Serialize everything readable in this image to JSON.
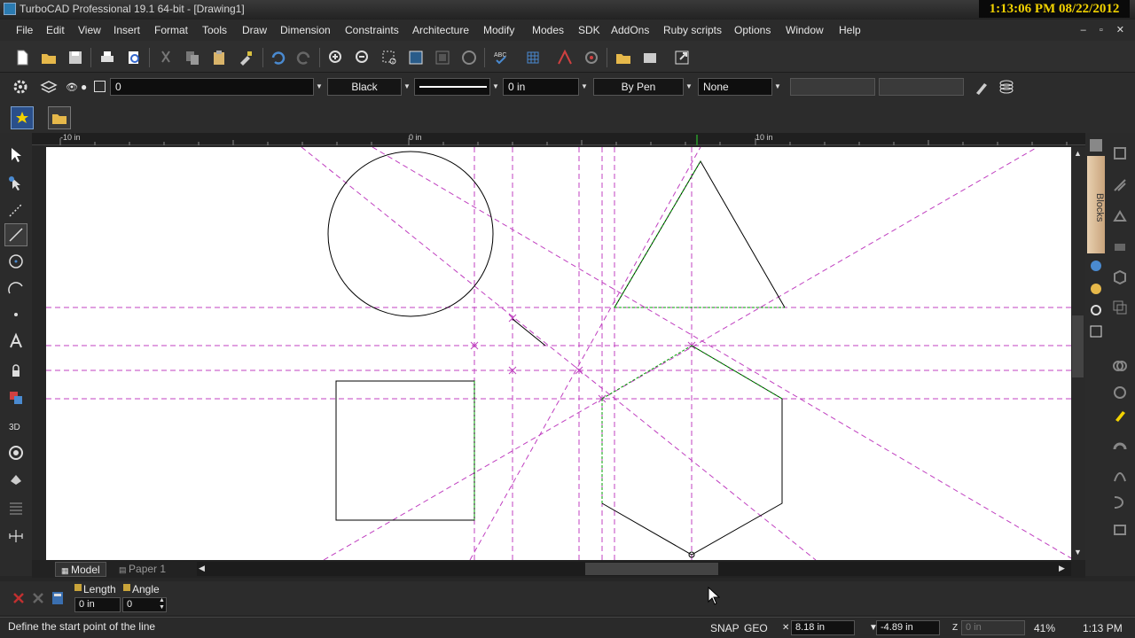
{
  "window": {
    "title": "TurboCAD Professional 19.1 64-bit - [Drawing1]",
    "controls": "– ▫ ✕"
  },
  "clock": "1:13:06 PM 08/22/2012",
  "menu": [
    "File",
    "Edit",
    "View",
    "Insert",
    "Format",
    "Tools",
    "Draw",
    "Dimension",
    "Constraints",
    "Architecture",
    "Modify",
    "Modes",
    "SDK",
    "AddOns",
    "Ruby scripts",
    "Options",
    "Window",
    "Help"
  ],
  "properties": {
    "layer": "0",
    "color": "Black",
    "line_width": "0 in",
    "pen": "By Pen",
    "fill": "None"
  },
  "ruler": {
    "labels": [
      "-10 in",
      "0 in",
      "10 in"
    ]
  },
  "right_panel": {
    "blocks_tab": "Blocks"
  },
  "sheets": {
    "model": "Model",
    "paper": "Paper 1"
  },
  "inspector": {
    "length_label": "Length",
    "angle_label": "Angle",
    "length_value": "0 in",
    "angle_value": "0"
  },
  "status": {
    "prompt": "Define the start point of the line",
    "snap": "SNAP",
    "geo": "GEO",
    "x": "8.18 in",
    "y": "-4.89 in",
    "z": "0 in",
    "zoom": "41%",
    "time": "1:13 PM"
  },
  "colors": {
    "construction": "#c040c0",
    "geometry": "#000000",
    "highlight": "#00a000",
    "clock": "#f2d200"
  }
}
